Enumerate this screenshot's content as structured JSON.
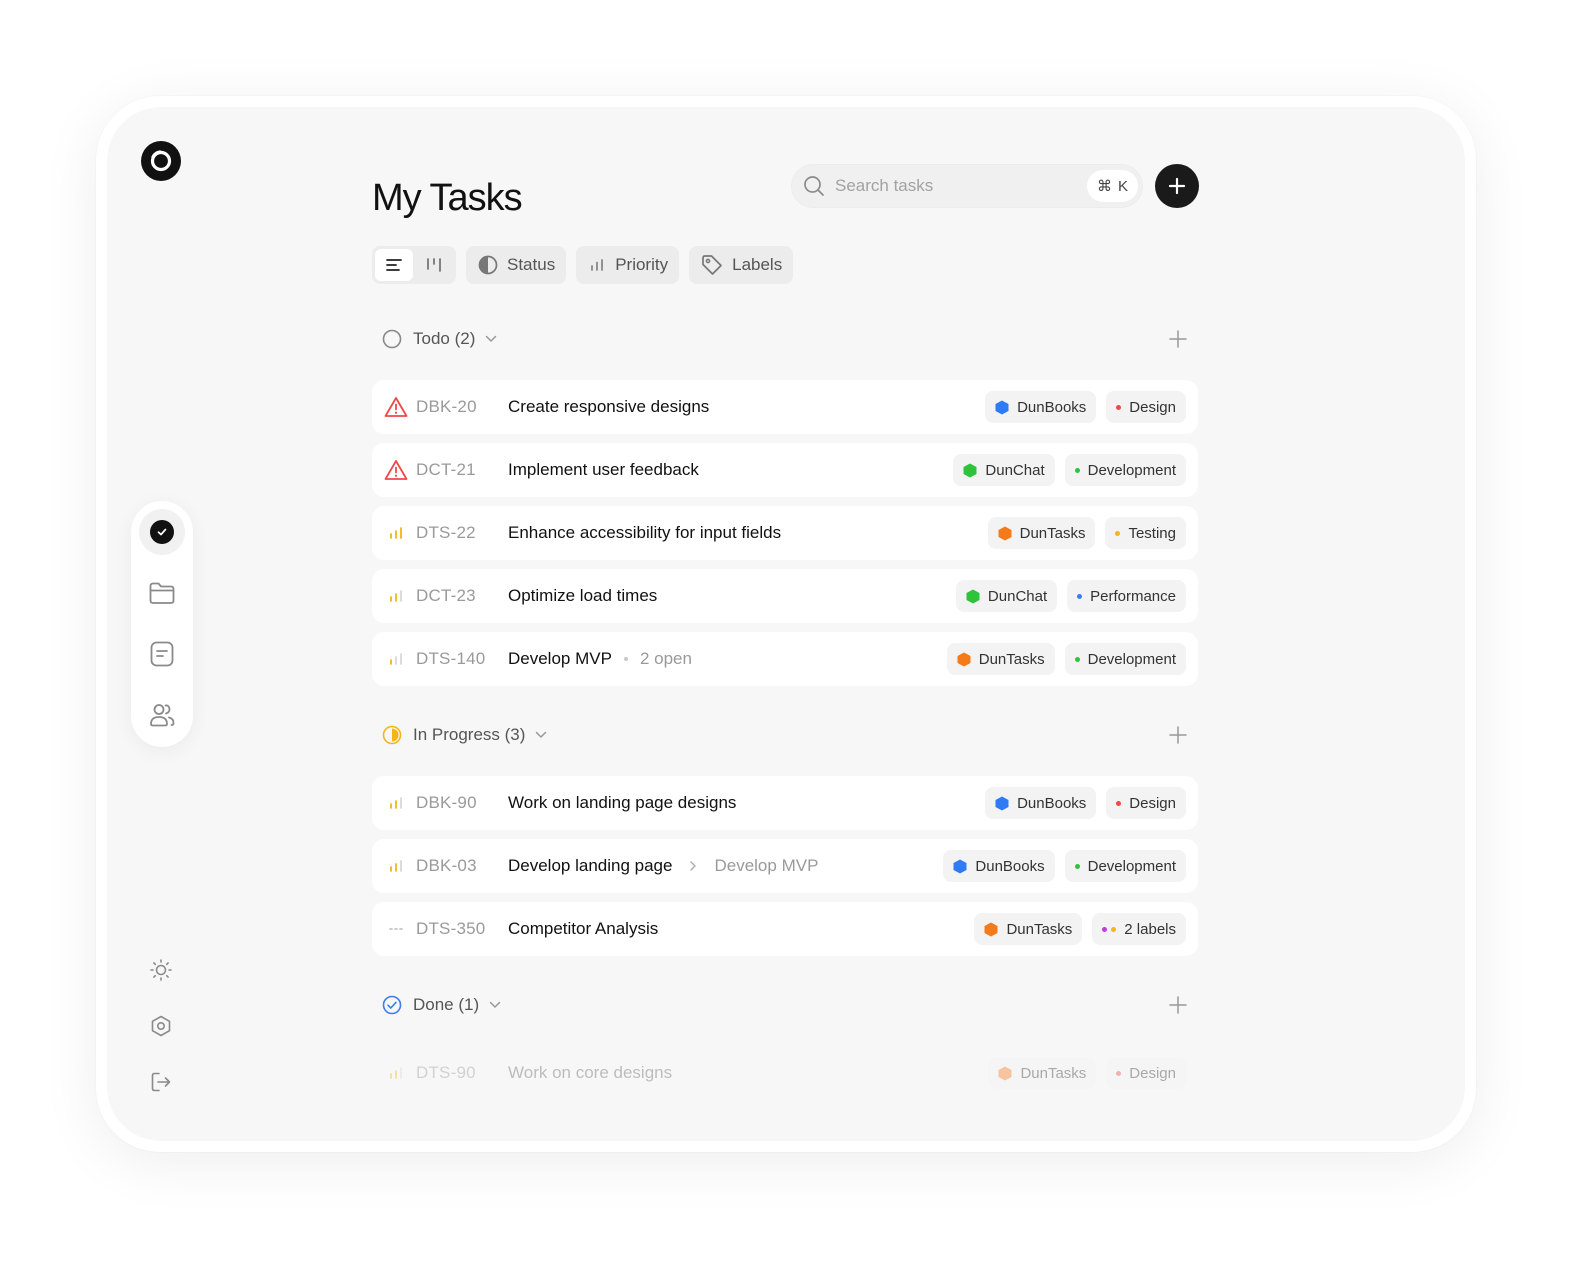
{
  "header": {
    "title": "My Tasks",
    "search_placeholder": "Search tasks",
    "shortcut_symbol": "⌘",
    "shortcut_key": "K"
  },
  "toolbar": {
    "status_label": "Status",
    "priority_label": "Priority",
    "labels_label": "Labels"
  },
  "colors": {
    "dunbooks": "#2f7bf5",
    "dunchat": "#2fc33c",
    "duntasks": "#f57a1a",
    "design": "#f04848",
    "development": "#2fc33c",
    "testing": "#f5b51a",
    "performance": "#3b7df5",
    "urgent": "#f04848",
    "priority_bars": "#f5b51a",
    "in_progress": "#f5b51a",
    "done": "#3b7df5"
  },
  "groups": {
    "todo": {
      "label": "Todo (2)",
      "rows": [
        {
          "id": "DBK-20",
          "title": "Create responsive designs",
          "project": "DunBooks",
          "label": "Design"
        },
        {
          "id": "DCT-21",
          "title": "Implement user feedback",
          "project": "DunChat",
          "label": "Development"
        },
        {
          "id": "DTS-22",
          "title": "Enhance accessibility for input fields",
          "project": "DunTasks",
          "label": "Testing"
        },
        {
          "id": "DCT-23",
          "title": "Optimize load times",
          "project": "DunChat",
          "label": "Performance"
        },
        {
          "id": "DTS-140",
          "title": "Develop MVP",
          "sub": "2 open",
          "project": "DunTasks",
          "label": "Development"
        }
      ]
    },
    "in_progress": {
      "label": "In Progress (3)",
      "rows": [
        {
          "id": "DBK-90",
          "title": "Work on landing page designs",
          "project": "DunBooks",
          "label": "Design"
        },
        {
          "id": "DBK-03",
          "title": "Develop landing page",
          "parent": "Develop MVP",
          "project": "DunBooks",
          "label": "Development"
        },
        {
          "id": "DTS-350",
          "title": "Competitor Analysis",
          "project": "DunTasks",
          "label": "2 labels"
        }
      ]
    },
    "done": {
      "label": "Done (1)",
      "rows": [
        {
          "id": "DTS-90",
          "title": "Work on core designs",
          "project": "DunTasks",
          "label": "Design"
        }
      ]
    }
  }
}
